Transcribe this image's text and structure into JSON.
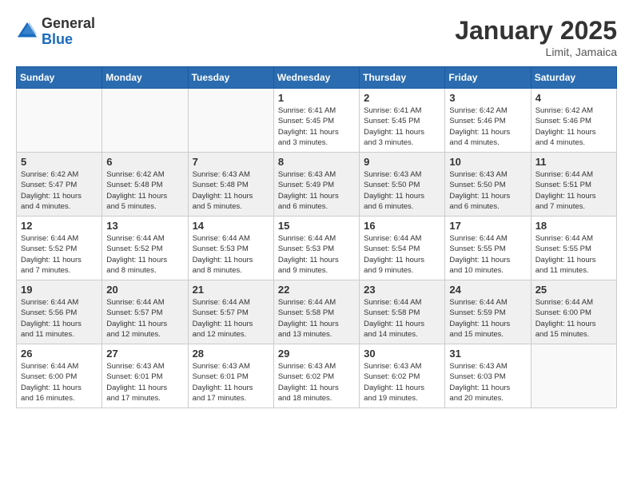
{
  "logo": {
    "general": "General",
    "blue": "Blue"
  },
  "header": {
    "month": "January 2025",
    "location": "Limit, Jamaica"
  },
  "weekdays": [
    "Sunday",
    "Monday",
    "Tuesday",
    "Wednesday",
    "Thursday",
    "Friday",
    "Saturday"
  ],
  "weeks": [
    [
      {
        "day": "",
        "info": ""
      },
      {
        "day": "",
        "info": ""
      },
      {
        "day": "",
        "info": ""
      },
      {
        "day": "1",
        "info": "Sunrise: 6:41 AM\nSunset: 5:45 PM\nDaylight: 11 hours\nand 3 minutes."
      },
      {
        "day": "2",
        "info": "Sunrise: 6:41 AM\nSunset: 5:45 PM\nDaylight: 11 hours\nand 3 minutes."
      },
      {
        "day": "3",
        "info": "Sunrise: 6:42 AM\nSunset: 5:46 PM\nDaylight: 11 hours\nand 4 minutes."
      },
      {
        "day": "4",
        "info": "Sunrise: 6:42 AM\nSunset: 5:46 PM\nDaylight: 11 hours\nand 4 minutes."
      }
    ],
    [
      {
        "day": "5",
        "info": "Sunrise: 6:42 AM\nSunset: 5:47 PM\nDaylight: 11 hours\nand 4 minutes."
      },
      {
        "day": "6",
        "info": "Sunrise: 6:42 AM\nSunset: 5:48 PM\nDaylight: 11 hours\nand 5 minutes."
      },
      {
        "day": "7",
        "info": "Sunrise: 6:43 AM\nSunset: 5:48 PM\nDaylight: 11 hours\nand 5 minutes."
      },
      {
        "day": "8",
        "info": "Sunrise: 6:43 AM\nSunset: 5:49 PM\nDaylight: 11 hours\nand 6 minutes."
      },
      {
        "day": "9",
        "info": "Sunrise: 6:43 AM\nSunset: 5:50 PM\nDaylight: 11 hours\nand 6 minutes."
      },
      {
        "day": "10",
        "info": "Sunrise: 6:43 AM\nSunset: 5:50 PM\nDaylight: 11 hours\nand 6 minutes."
      },
      {
        "day": "11",
        "info": "Sunrise: 6:44 AM\nSunset: 5:51 PM\nDaylight: 11 hours\nand 7 minutes."
      }
    ],
    [
      {
        "day": "12",
        "info": "Sunrise: 6:44 AM\nSunset: 5:52 PM\nDaylight: 11 hours\nand 7 minutes."
      },
      {
        "day": "13",
        "info": "Sunrise: 6:44 AM\nSunset: 5:52 PM\nDaylight: 11 hours\nand 8 minutes."
      },
      {
        "day": "14",
        "info": "Sunrise: 6:44 AM\nSunset: 5:53 PM\nDaylight: 11 hours\nand 8 minutes."
      },
      {
        "day": "15",
        "info": "Sunrise: 6:44 AM\nSunset: 5:53 PM\nDaylight: 11 hours\nand 9 minutes."
      },
      {
        "day": "16",
        "info": "Sunrise: 6:44 AM\nSunset: 5:54 PM\nDaylight: 11 hours\nand 9 minutes."
      },
      {
        "day": "17",
        "info": "Sunrise: 6:44 AM\nSunset: 5:55 PM\nDaylight: 11 hours\nand 10 minutes."
      },
      {
        "day": "18",
        "info": "Sunrise: 6:44 AM\nSunset: 5:55 PM\nDaylight: 11 hours\nand 11 minutes."
      }
    ],
    [
      {
        "day": "19",
        "info": "Sunrise: 6:44 AM\nSunset: 5:56 PM\nDaylight: 11 hours\nand 11 minutes."
      },
      {
        "day": "20",
        "info": "Sunrise: 6:44 AM\nSunset: 5:57 PM\nDaylight: 11 hours\nand 12 minutes."
      },
      {
        "day": "21",
        "info": "Sunrise: 6:44 AM\nSunset: 5:57 PM\nDaylight: 11 hours\nand 12 minutes."
      },
      {
        "day": "22",
        "info": "Sunrise: 6:44 AM\nSunset: 5:58 PM\nDaylight: 11 hours\nand 13 minutes."
      },
      {
        "day": "23",
        "info": "Sunrise: 6:44 AM\nSunset: 5:58 PM\nDaylight: 11 hours\nand 14 minutes."
      },
      {
        "day": "24",
        "info": "Sunrise: 6:44 AM\nSunset: 5:59 PM\nDaylight: 11 hours\nand 15 minutes."
      },
      {
        "day": "25",
        "info": "Sunrise: 6:44 AM\nSunset: 6:00 PM\nDaylight: 11 hours\nand 15 minutes."
      }
    ],
    [
      {
        "day": "26",
        "info": "Sunrise: 6:44 AM\nSunset: 6:00 PM\nDaylight: 11 hours\nand 16 minutes."
      },
      {
        "day": "27",
        "info": "Sunrise: 6:43 AM\nSunset: 6:01 PM\nDaylight: 11 hours\nand 17 minutes."
      },
      {
        "day": "28",
        "info": "Sunrise: 6:43 AM\nSunset: 6:01 PM\nDaylight: 11 hours\nand 17 minutes."
      },
      {
        "day": "29",
        "info": "Sunrise: 6:43 AM\nSunset: 6:02 PM\nDaylight: 11 hours\nand 18 minutes."
      },
      {
        "day": "30",
        "info": "Sunrise: 6:43 AM\nSunset: 6:02 PM\nDaylight: 11 hours\nand 19 minutes."
      },
      {
        "day": "31",
        "info": "Sunrise: 6:43 AM\nSunset: 6:03 PM\nDaylight: 11 hours\nand 20 minutes."
      },
      {
        "day": "",
        "info": ""
      }
    ]
  ]
}
